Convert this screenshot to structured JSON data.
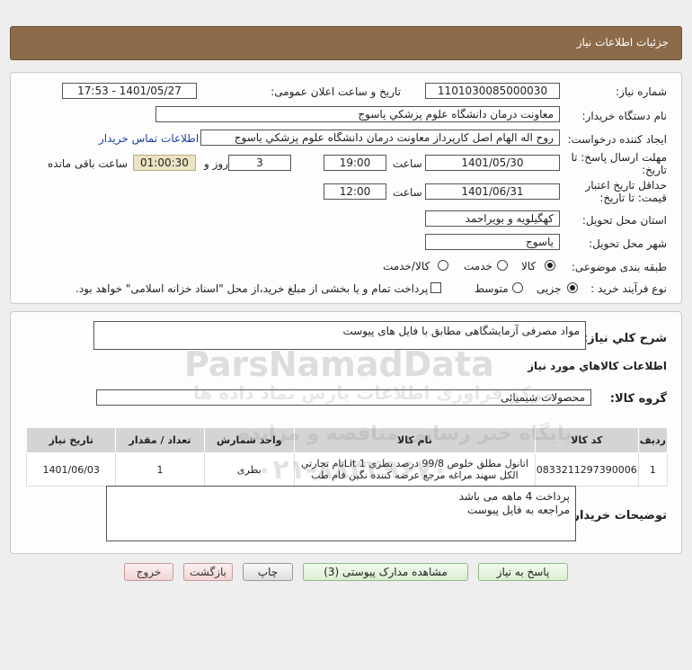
{
  "header": {
    "title": "جزئیات اطلاعات نیاز"
  },
  "form": {
    "need_number_label": "شماره نیاز:",
    "need_number": "1101030085000030",
    "announce_label": "تاریخ و ساعت اعلان عمومی:",
    "announce_value": "1401/05/27 - 17:53",
    "buyer_org_label": "نام دستگاه خریدار:",
    "buyer_org": "معاونت درمان دانشگاه علوم پزشکي ياسوج",
    "requester_label": "ایجاد کننده درخواست:",
    "requester": "روح اله الهام اصل کارپرداز معاونت درمان دانشگاه علوم پزشکي ياسوج",
    "contact_link": "اطلاعات تماس خریدار",
    "deadline_label_line1": "مهلت ارسال پاسخ: تا",
    "deadline_label_line2": "تاریخ:",
    "deadline_date": "1401/05/30",
    "time_label": "ساعت",
    "deadline_time": "19:00",
    "days_value": "3",
    "days_label": "روز و",
    "remaining_time": "01:00:30",
    "remaining_label": "ساعت باقی مانده",
    "validity_label_line1": "حداقل تاریخ اعتبار",
    "validity_label_line2": "قیمت: تا تاریخ:",
    "validity_date": "1401/06/31",
    "validity_time": "12:00",
    "province_label": "استان محل تحویل:",
    "province": "کهگیلویه و بویراحمد",
    "city_label": "شهر محل تحویل:",
    "city": "یاسوج",
    "category_label": "طبقه بندی موضوعی:",
    "category_options": [
      "کالا",
      "خدمت",
      "کالا/خدمت"
    ],
    "category_selected": "کالا",
    "process_label": "نوع فرآیند خرید :",
    "process_options": [
      "جزیی",
      "متوسط"
    ],
    "process_selected": "جزیی",
    "payment_note": "پرداخت تمام و یا بخشی از مبلغ خرید،از محل \"اسناد خزانه اسلامی\" خواهد بود."
  },
  "details": {
    "summary_label": "شرح کلي نياز:",
    "summary": "مواد مصرفی آزمایشگاهی مطابق با فایل های پیوست",
    "goods_title": "اطلاعات کالاهاي مورد نياز",
    "group_label": "گروه کالا:",
    "group_value": "محصولات شیمیائی",
    "table": {
      "headers": [
        "ردیف",
        "کد کالا",
        "نام کالا",
        "واحد شمارش",
        "تعداد / مقدار",
        "تاریخ نیاز"
      ],
      "rows": [
        {
          "row": "1",
          "code": "0833211297390006",
          "name": "اتانول مطلق خلوص 99/8 درصد بطری Lit 1نام تجارتي الکل سهند مراغه مرجع عرضه کننده نگین فام طب",
          "unit": "بطری",
          "qty": "1",
          "date": "1401/06/03"
        }
      ]
    },
    "buyer_notes_label": "توضیحات خریدار:",
    "buyer_notes_line1": "پرداخت 4 ماهه می باشد",
    "buyer_notes_line2": "مراجعه به فایل پیوست"
  },
  "buttons": {
    "reply": "پاسخ به نیاز",
    "attachments": "مشاهده مدارک پیوستی (3)",
    "print": "چاپ",
    "back": "بازگشت",
    "exit": "خروج"
  },
  "watermark": {
    "brand": "ParsNamadData",
    "line1": "مرکز فراوری اطلاعات پارس نماد داده ها",
    "line2": "پایگاه خبر رسانی مناقصه و مزایده",
    "phone": "۰۲۱-۸۸۳۴۹۶۷۰"
  },
  "colors": {
    "header": "#8c6b4a",
    "link": "#1a3fa0",
    "remaining_bg": "#ece3c4"
  }
}
